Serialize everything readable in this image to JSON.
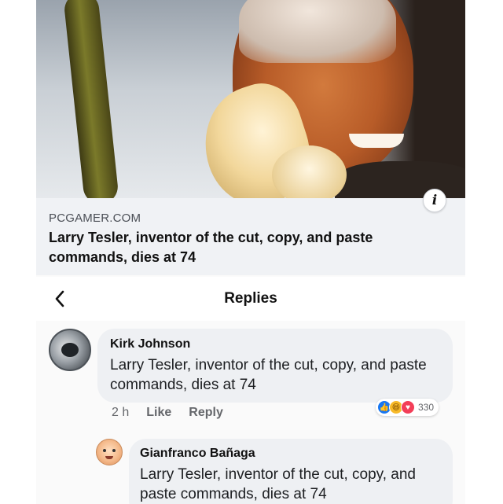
{
  "link_preview": {
    "source": "PCGAMER.COM",
    "title": "Larry Tesler, inventor of the cut, copy, and paste commands, dies at 74",
    "info_icon_glyph": "i"
  },
  "header": {
    "title": "Replies",
    "back_icon": "chevron-left-icon"
  },
  "comments": [
    {
      "author": "Kirk Johnson",
      "text": "Larry Tesler, inventor of the cut, copy, and paste commands, dies at 74",
      "time": "2 h",
      "like_label": "Like",
      "reply_label": "Reply",
      "reactions": [
        "like",
        "haha",
        "love"
      ],
      "reaction_count": "330"
    },
    {
      "author": "Gianfranco Bañaga",
      "text": "Larry Tesler, inventor of the cut, copy, and paste commands, dies at 74"
    }
  ],
  "colors": {
    "bubble": "#eef0f3",
    "like_reaction": "#1877f2",
    "haha_reaction": "#f7b928",
    "love_reaction": "#f33e58"
  }
}
